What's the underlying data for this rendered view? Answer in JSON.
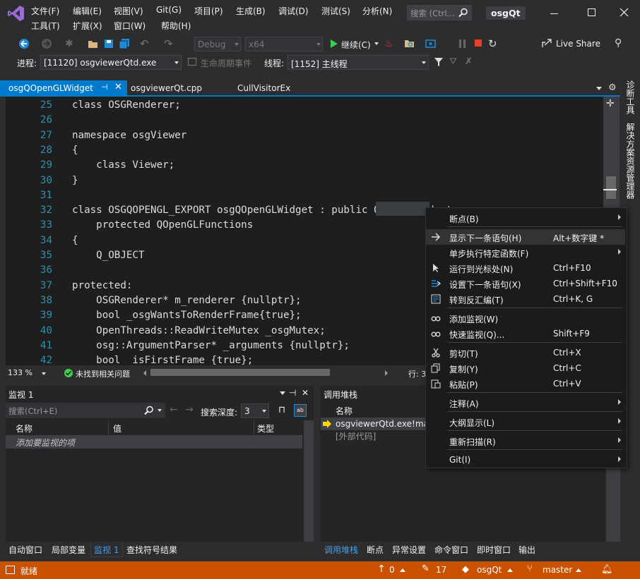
{
  "window": {
    "title": "osgQt"
  },
  "menu": {
    "row1": [
      "文件(F)",
      "编辑(E)",
      "视图(V)",
      "Git(G)",
      "项目(P)",
      "生成(B)",
      "调试(D)",
      "测试(S)",
      "分析(N)"
    ],
    "row2": [
      "工具(T)",
      "扩展(X)",
      "窗口(W)",
      "帮助(H)"
    ],
    "search_placeholder": "搜索 (Ctrl..."
  },
  "toolbar": {
    "config": "Debug",
    "platform": "x64",
    "continue": "继续(C)",
    "live_share": "Live Share"
  },
  "debugbar": {
    "process_label": "进程:",
    "process_value": "[11120] osgviewerQtd.exe",
    "lifecycle": "生命周期事件",
    "thread_label": "线程:",
    "thread_value": "[1152] 主线程"
  },
  "tabs": [
    {
      "label": "osgQOpenGLWidget",
      "active": true
    },
    {
      "label": "osgviewerQt.cpp",
      "active": false
    },
    {
      "label": "CullVisitorEx",
      "active": false
    }
  ],
  "right_strip": [
    "诊断工具",
    "解决方案资源管理器"
  ],
  "code": {
    "lines": [
      {
        "n": "25",
        "text": "class OSGRenderer;"
      },
      {
        "n": "26",
        "text": ""
      },
      {
        "n": "27",
        "text": "namespace osgViewer"
      },
      {
        "n": "28",
        "text": "{"
      },
      {
        "n": "29",
        "text": "    class Viewer;"
      },
      {
        "n": "30",
        "text": "}"
      },
      {
        "n": "31",
        "text": ""
      },
      {
        "n": "32",
        "text": "class OSGQOPENGL_EXPORT osgQOpenGLWidget : public QOpenGLWidget,"
      },
      {
        "n": "33",
        "text": "    protected QOpenGLFunctions"
      },
      {
        "n": "34",
        "text": "{"
      },
      {
        "n": "35",
        "text": "    Q_OBJECT"
      },
      {
        "n": "36",
        "text": ""
      },
      {
        "n": "37",
        "text": "protected:"
      },
      {
        "n": "38",
        "text": "    OSGRenderer* m_renderer {nullptr};"
      },
      {
        "n": "39",
        "text": "    bool _osgWantsToRenderFrame{true};"
      },
      {
        "n": "40",
        "text": "    OpenThreads::ReadWriteMutex _osgMutex;"
      },
      {
        "n": "41",
        "text": "    osg::ArgumentParser* _arguments {nullptr};"
      },
      {
        "n": "42",
        "text": "    bool _isFirstFrame {true};"
      }
    ]
  },
  "editor_status": {
    "zoom": "133 %",
    "issues": "未找到相关问题",
    "line": "行: 3"
  },
  "watch": {
    "title": "监视 1",
    "search_placeholder": "搜索(Ctrl+E)",
    "depth_label": "搜索深度:",
    "depth_value": "3",
    "col_name": "名称",
    "col_value": "值",
    "col_type": "类型",
    "add_item": "添加要监视的项"
  },
  "callstack": {
    "title": "调用堆栈",
    "col_name": "名称",
    "rows": [
      "osgviewerQtd.exe!main(",
      "[外部代码]"
    ]
  },
  "bottom_tabs_left": [
    "自动窗口",
    "局部变量",
    "监视 1",
    "查找符号结果"
  ],
  "bottom_tabs_right": [
    "调用堆栈",
    "断点",
    "异常设置",
    "命令窗口",
    "即时窗口",
    "输出"
  ],
  "context_menu": {
    "items": [
      {
        "label": "断点(B)",
        "shortcut": "",
        "submenu": true,
        "icon": ""
      },
      {
        "label": "显示下一条语句(H)",
        "shortcut": "Alt+数字键 *",
        "submenu": false,
        "icon": "arrow-right-icon"
      },
      {
        "label": "单步执行特定函数(F)",
        "shortcut": "",
        "submenu": true,
        "icon": ""
      },
      {
        "label": "运行到光标处(N)",
        "shortcut": "Ctrl+F10",
        "submenu": false,
        "icon": "cursor-icon"
      },
      {
        "label": "设置下一条语句(X)",
        "shortcut": "Ctrl+Shift+F10",
        "submenu": false,
        "icon": "set-next-icon"
      },
      {
        "label": "转到反汇编(T)",
        "shortcut": "Ctrl+K, G",
        "submenu": false,
        "icon": "disassembly-icon"
      },
      {
        "label": "添加监视(W)",
        "shortcut": "",
        "submenu": false,
        "icon": "glasses-icon"
      },
      {
        "label": "快速监视(Q)...",
        "shortcut": "Shift+F9",
        "submenu": false,
        "icon": "glasses-icon"
      },
      {
        "label": "剪切(T)",
        "shortcut": "Ctrl+X",
        "submenu": false,
        "icon": "scissors-icon"
      },
      {
        "label": "复制(Y)",
        "shortcut": "Ctrl+C",
        "submenu": false,
        "icon": "copy-icon"
      },
      {
        "label": "粘贴(P)",
        "shortcut": "Ctrl+V",
        "submenu": false,
        "icon": "paste-icon"
      },
      {
        "label": "注释(A)",
        "shortcut": "",
        "submenu": true,
        "icon": ""
      },
      {
        "label": "大纲显示(L)",
        "shortcut": "",
        "submenu": true,
        "icon": ""
      },
      {
        "label": "重新扫描(R)",
        "shortcut": "",
        "submenu": true,
        "icon": ""
      },
      {
        "label": "Git(I)",
        "shortcut": "",
        "submenu": true,
        "icon": ""
      }
    ]
  },
  "statusbar": {
    "text": "就绪",
    "up": "0",
    "edits": "17",
    "repo": "osgQt",
    "branch": "master"
  },
  "colors": {
    "accent": "#007acc",
    "status_bg": "#ca5100",
    "tab_active": "#007acc"
  }
}
